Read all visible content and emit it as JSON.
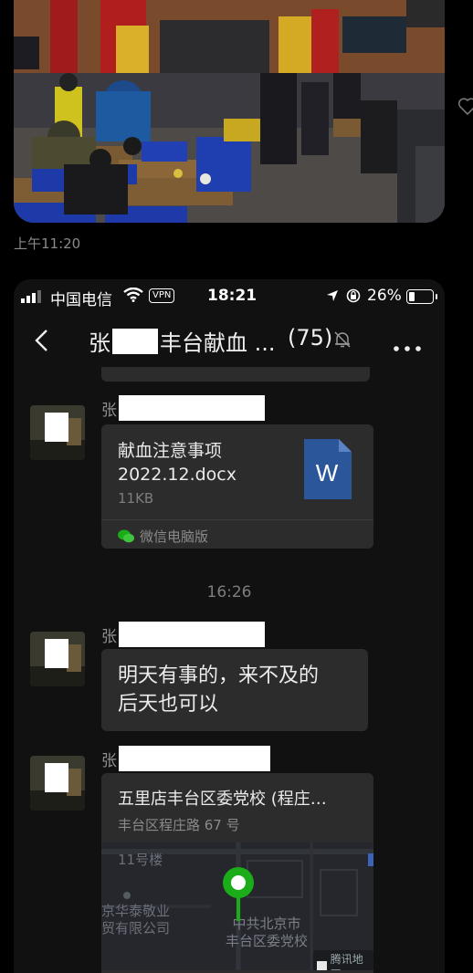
{
  "top": {
    "timestamp": "上午11:20"
  },
  "status_bar": {
    "carrier": "中国电信",
    "vpn": "VPN",
    "time": "18:21",
    "battery": "26%"
  },
  "nav": {
    "title_prefix": "张",
    "title_suffix": "丰台献血 ...",
    "member_count": "(75)"
  },
  "messages": [
    {
      "sender_initial": "张",
      "type": "file",
      "file_name_line1": "献血注意事项",
      "file_name_line2": "2022.12.docx",
      "file_size": "11KB",
      "source": "微信电脑版",
      "file_icon_letter": "W"
    },
    {
      "time_stamp": "16:26"
    },
    {
      "sender_initial": "张",
      "type": "text",
      "line1": "明天有事的，来不及的",
      "line2": "后天也可以"
    },
    {
      "sender_initial": "张",
      "type": "location",
      "title": "五里店丰台区委党校 (程庄…",
      "address": "丰台区程庄路 67 号",
      "map_label_1": "11号楼",
      "map_label_2a": "京华泰敬业",
      "map_label_2b": "贸有限公司",
      "map_label_3a": "中共北京市",
      "map_label_3b": "丰台区委党校",
      "map_provider": "腾讯地图"
    }
  ],
  "colors": {
    "background": "#000000",
    "chat_bg": "#111111",
    "bubble": "#2c2c2c",
    "word_blue": "#2b579a",
    "pin_green": "#1aad19"
  }
}
